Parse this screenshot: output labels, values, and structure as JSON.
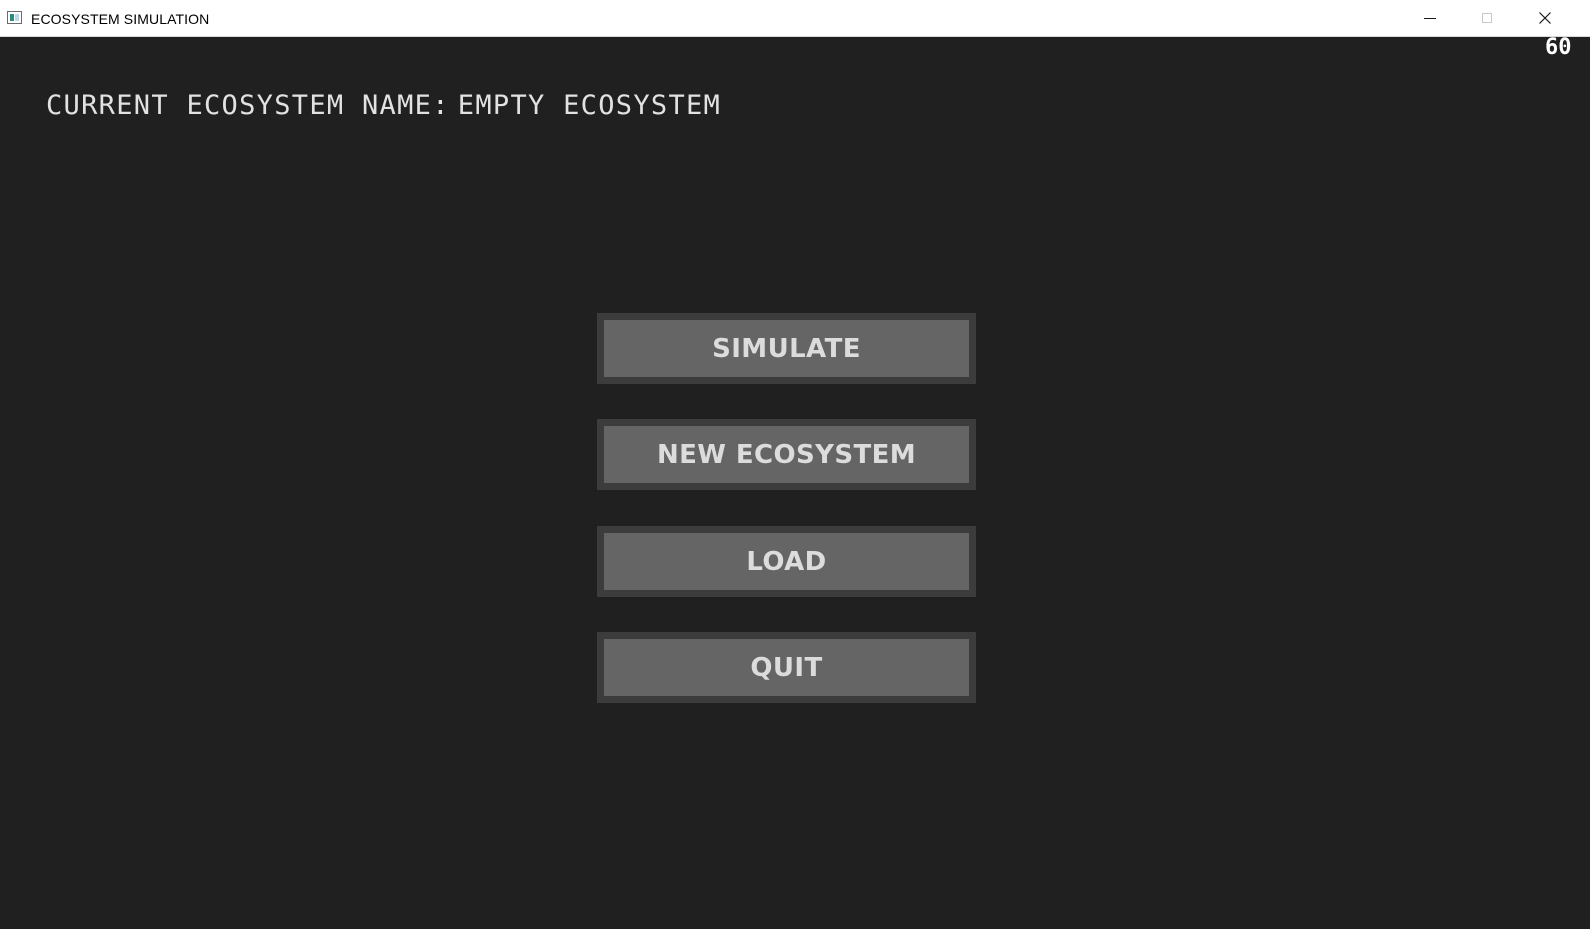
{
  "window": {
    "title": "ECOSYSTEM SIMULATION",
    "app_icon": "app-window-icon",
    "controls": {
      "minimize_icon": "minimize-icon",
      "maximize_icon": "maximize-icon",
      "close_icon": "close-icon"
    }
  },
  "fps_counter": "60",
  "ecosystem": {
    "label": "CURRENT ECOSYSTEM NAME:",
    "name": "EMPTY ECOSYSTEM"
  },
  "menu": {
    "simulate_label": "SIMULATE",
    "new_ecosystem_label": "NEW ECOSYSTEM",
    "load_label": "LOAD",
    "quit_label": "QUIT"
  },
  "colors": {
    "background": "#202020",
    "button_border": "#3c3c3c",
    "button_face": "#656565",
    "button_text": "#dcdcdc",
    "heading_text": "#e2e2e2"
  }
}
